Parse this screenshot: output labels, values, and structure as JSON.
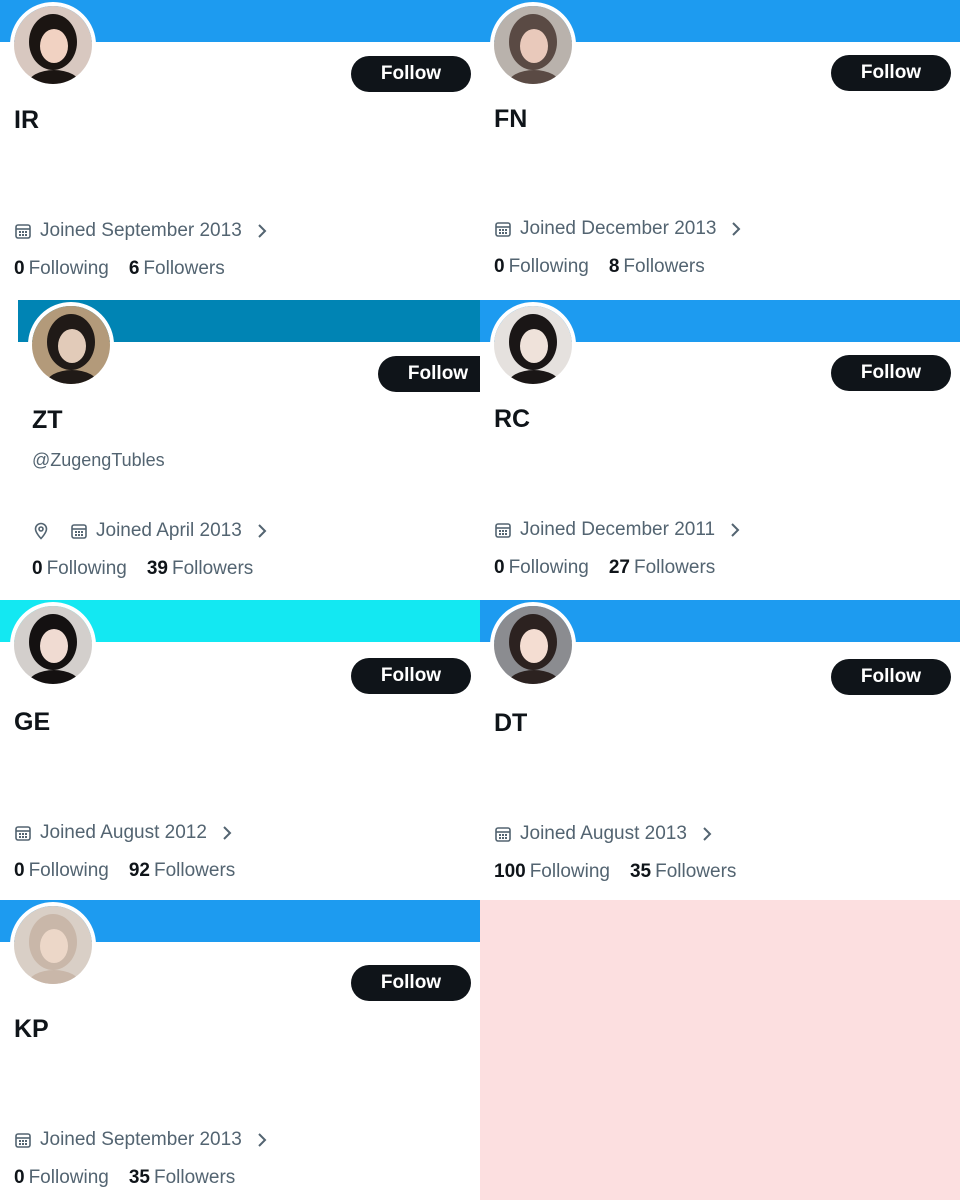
{
  "follow_label": "Follow",
  "following_label": "Following",
  "followers_label": "Followers",
  "colors": {
    "banner_blue": "#1d9bf0",
    "banner_teal": "#0084b4",
    "banner_cyan": "#13e8f2",
    "follow_button": "#0f1419",
    "muted_text": "#536471",
    "filler_pink": "#fcdfe0"
  },
  "cards": [
    {
      "name": "IR",
      "handle": "",
      "bio": "",
      "location_icon": false,
      "joined": "Joined September 2013",
      "following": "0",
      "followers": "6",
      "banner": "#1d9bf0"
    },
    {
      "name": "FN",
      "handle": "",
      "bio": "",
      "location_icon": false,
      "joined": "Joined December 2013",
      "following": "0",
      "followers": "8",
      "banner": "#1d9bf0"
    },
    {
      "name": "ZT",
      "handle": "@ZugengTubles",
      "bio": "",
      "location_icon": true,
      "joined": "Joined April 2013",
      "following": "0",
      "followers": "39",
      "banner": "#0084b4"
    },
    {
      "name": "RC",
      "handle": "",
      "bio": "",
      "location_icon": false,
      "joined": "Joined December 2011",
      "following": "0",
      "followers": "27",
      "banner": "#1d9bf0"
    },
    {
      "name": "GE",
      "handle": "",
      "bio": "",
      "location_icon": false,
      "joined": "Joined August 2012",
      "following": "0",
      "followers": "92",
      "banner": "#13e8f2"
    },
    {
      "name": "DT",
      "handle": "",
      "bio": "",
      "location_icon": false,
      "joined": "Joined August 2013",
      "following": "100",
      "followers": "35",
      "banner": "#1d9bf0"
    },
    {
      "name": "KP",
      "handle": "",
      "bio": "",
      "location_icon": false,
      "joined": "Joined September 2013",
      "following": "0",
      "followers": "35",
      "banner": "#1d9bf0"
    }
  ]
}
